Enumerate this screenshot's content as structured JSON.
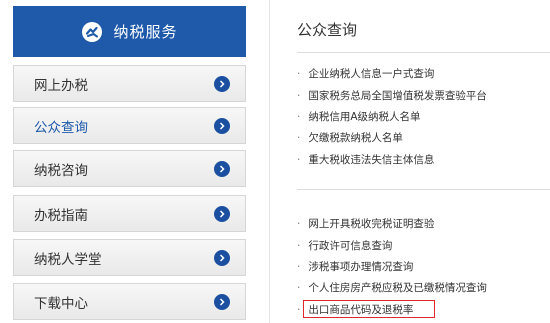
{
  "sidebar": {
    "header_title": "纳税服务",
    "items": [
      {
        "label": "网上办税"
      },
      {
        "label": "公众查询"
      },
      {
        "label": "纳税咨询"
      },
      {
        "label": "办税指南"
      },
      {
        "label": "纳税人学堂"
      },
      {
        "label": "下载中心"
      }
    ],
    "active_index": 1
  },
  "content": {
    "heading": "公众查询",
    "group1": [
      "企业纳税人信息一户式查询",
      "国家税务总局全国增值税发票查验平台",
      "纳税信用A级纳税人名单",
      "欠缴税款纳税人名单",
      "重大税收违法失信主体信息"
    ],
    "group2": [
      "网上开具税收完税证明查验",
      "行政许可信息查询",
      "涉税事项办理情况查询",
      "个人住房房产税应税及已缴税情况查询",
      "出口商品代码及退税率"
    ],
    "highlighted_item": "出口商品代码及退税率",
    "bullet": "·"
  },
  "colors": {
    "brand_blue": "#1e5aa9",
    "arrow_blue": "#1b4fa0",
    "highlight_red": "#e0292b"
  },
  "icons": {
    "logo": "tax-service-logo-icon",
    "arrow": "chevron-right-circle-icon"
  }
}
